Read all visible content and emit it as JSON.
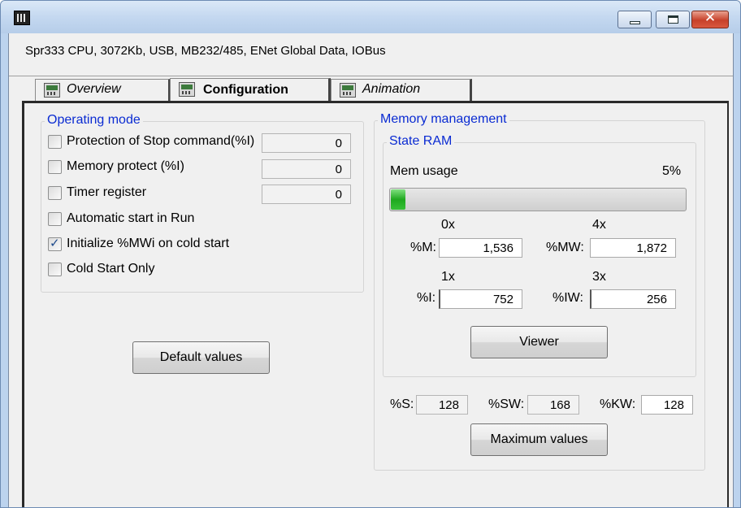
{
  "window": {
    "title": ""
  },
  "header": {
    "description": "Spr333 CPU, 3072Kb, USB, MB232/485, ENet Global Data, IOBus"
  },
  "tabs": [
    {
      "label": "Overview",
      "active": false
    },
    {
      "label": "Configuration",
      "active": true
    },
    {
      "label": "Animation",
      "active": false
    }
  ],
  "operating_mode": {
    "title": "Operating mode",
    "options": [
      {
        "label": "Protection of Stop command(%I)",
        "checked": false,
        "value": "0"
      },
      {
        "label": "Memory protect (%I)",
        "checked": false,
        "value": "0"
      },
      {
        "label": "Timer register",
        "checked": false,
        "value": "0"
      },
      {
        "label": "Automatic start in Run",
        "checked": false
      },
      {
        "label": "Initialize %MWi on cold start",
        "checked": true
      },
      {
        "label": "Cold Start Only",
        "checked": false
      }
    ],
    "default_button": "Default values"
  },
  "memory": {
    "title": "Memory management",
    "state_ram": {
      "title": "State RAM",
      "mem_usage_label": "Mem usage",
      "mem_usage_value": "5%",
      "mem_usage_fraction": 0.05,
      "m_header": "0x",
      "mw_header": "4x",
      "m_label": "%M:",
      "m_value": "1,536",
      "mw_label": "%MW:",
      "mw_value": "1,872",
      "i_header": "1x",
      "iw_header": "3x",
      "i_label": "%I:",
      "i_value": "752",
      "iw_label": "%IW:",
      "iw_value": "256",
      "viewer_button": "Viewer"
    },
    "s_label": "%S:",
    "s_value": "128",
    "sw_label": "%SW:",
    "sw_value": "168",
    "kw_label": "%KW:",
    "kw_value": "128",
    "max_button": "Maximum values"
  },
  "colors": {
    "group_title": "#0a2bd2",
    "progress_fill": "#1fa81f",
    "close_button": "#c7412a"
  }
}
